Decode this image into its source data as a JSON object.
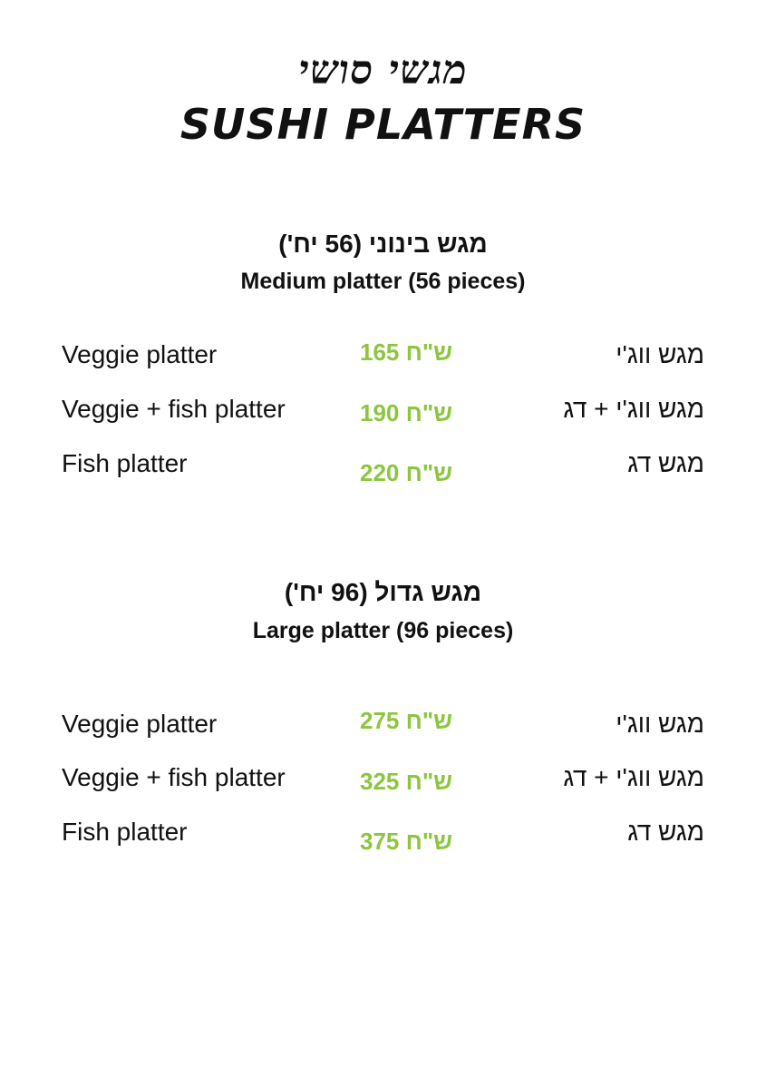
{
  "header": {
    "title_he": "מגשי סושי",
    "title_en": "SUSHI PLATTERS"
  },
  "sections": [
    {
      "title_he": "מגש בינוני (56 יח')",
      "title_en": "Medium platter (56 pieces)",
      "items": [
        {
          "name_en": "Veggie platter",
          "price": "165 ש\"ח",
          "name_he": "מגש ווג'י"
        },
        {
          "name_en": "Veggie + fish platter",
          "price": "190 ש\"ח",
          "name_he": "מגש ווג'י + דג"
        },
        {
          "name_en": "Fish platter",
          "price": "220 ש\"ח",
          "name_he": "מגש דג"
        }
      ]
    },
    {
      "title_he": "מגש גדול (96 יח')",
      "title_en": "Large platter (96 pieces)",
      "items": [
        {
          "name_en": "Veggie platter",
          "price": "275 ש\"ח",
          "name_he": "מגש ווג'י"
        },
        {
          "name_en": "Veggie + fish platter",
          "price": "325 ש\"ח",
          "name_he": "מגש ווג'י + דג"
        },
        {
          "name_en": "Fish platter",
          "price": "375 ש\"ח",
          "name_he": "מגש דג"
        }
      ]
    }
  ],
  "colors": {
    "price": "#8cc63f",
    "text": "#111111",
    "background": "#ffffff"
  }
}
